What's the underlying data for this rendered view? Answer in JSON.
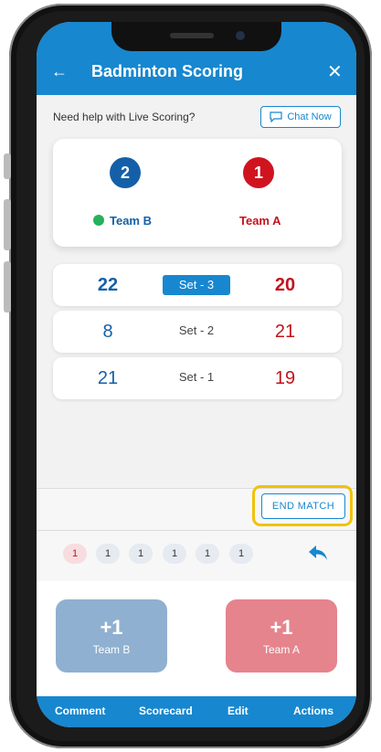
{
  "header": {
    "back_icon": "←",
    "title": "Badminton Scoring",
    "close_icon": "✕"
  },
  "help": {
    "text": "Need help with Live Scoring?",
    "chat_label": "Chat Now"
  },
  "scoreboard": {
    "team_b": {
      "name": "Team B",
      "sets_won": "2",
      "color": "#1460a8",
      "serving": true
    },
    "team_a": {
      "name": "Team A",
      "sets_won": "1",
      "color": "#d0141f"
    }
  },
  "sets": [
    {
      "label": "Set - 3",
      "team_b": "22",
      "team_a": "20",
      "active": true
    },
    {
      "label": "Set - 2",
      "team_b": "8",
      "team_a": "21",
      "active": false
    },
    {
      "label": "Set - 1",
      "team_b": "21",
      "team_a": "19",
      "active": false
    }
  ],
  "end_match_label": "END MATCH",
  "history_chips": [
    "1",
    "1",
    "1",
    "1",
    "1",
    "1"
  ],
  "score_buttons": {
    "team_b": {
      "plus": "+1",
      "name": "Team B"
    },
    "team_a": {
      "plus": "+1",
      "name": "Team A"
    }
  },
  "footer": {
    "comment": "Comment",
    "scorecard": "Scorecard",
    "edit": "Edit",
    "actions": "Actions"
  },
  "colors": {
    "accent": "#1787cf",
    "highlight": "#f0c20a",
    "serve": "#25b25a"
  }
}
